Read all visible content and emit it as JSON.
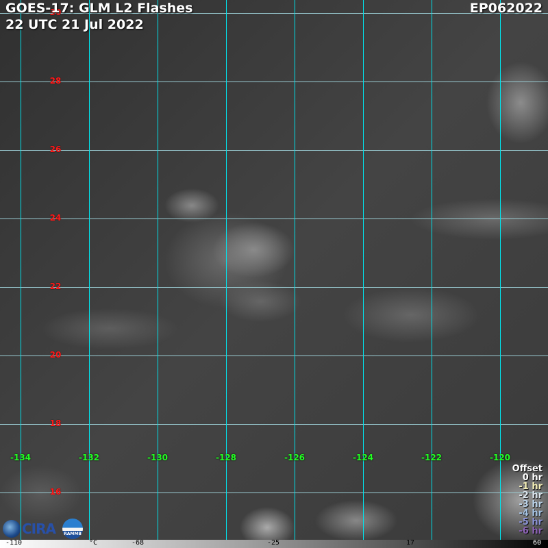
{
  "header": {
    "title": "GOES-17: GLM L2 Flashes",
    "datetime": "22 UTC 21 Jul 2022",
    "storm_id": "EP062022"
  },
  "grid": {
    "latitudes": [
      "30",
      "28",
      "26",
      "24",
      "22",
      "20",
      "18",
      "16"
    ],
    "longitudes": [
      "-134",
      "-132",
      "-130",
      "-128",
      "-126",
      "-124",
      "-122",
      "-120"
    ]
  },
  "legend": {
    "title": "Offset",
    "items": [
      {
        "label": "0 hr",
        "color": "#ffffff"
      },
      {
        "label": "-1 hr",
        "color": "#f5f0b8"
      },
      {
        "label": "-2 hr",
        "color": "#dce6ee"
      },
      {
        "label": "-3 hr",
        "color": "#bcd4ea"
      },
      {
        "label": "-4 hr",
        "color": "#a6c4e4"
      },
      {
        "label": "-5 hr",
        "color": "#8c94d8"
      },
      {
        "label": "-6 hr",
        "color": "#8e63b8"
      }
    ]
  },
  "colorbar": {
    "ticks": [
      "-110",
      "°C",
      "-68",
      "-25",
      "17",
      "60"
    ]
  },
  "logos": {
    "cira": "CIRA",
    "rammb": "RAMMB"
  }
}
